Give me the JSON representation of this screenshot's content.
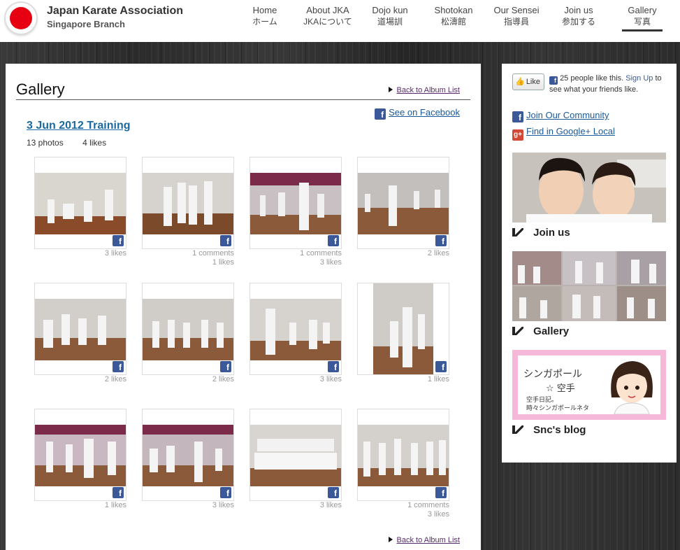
{
  "header": {
    "brand_title": "Japan Karate Association",
    "brand_sub": "Singapore Branch",
    "nav": [
      {
        "en": "Home",
        "jp": "ホーム"
      },
      {
        "en": "About JKA",
        "jp": "JKAについて"
      },
      {
        "en": "Dojo kun",
        "jp": "道場訓"
      },
      {
        "en": "Shotokan",
        "jp": "松濤館"
      },
      {
        "en": "Our Sensei",
        "jp": "指導員"
      },
      {
        "en": "Join us",
        "jp": "参加する"
      },
      {
        "en": "Gallery",
        "jp": "写真"
      }
    ],
    "active_nav": "Gallery"
  },
  "main": {
    "title": "Gallery",
    "back_link": "Back to Album List",
    "see_facebook": "See on Facebook",
    "album_title": "3 Jun 2012 Training",
    "photo_count": "13 photos",
    "like_count": "4 likes",
    "thumbs": [
      {
        "meta": [
          "3 likes"
        ]
      },
      {
        "meta": [
          "1 comments",
          "1 likes"
        ]
      },
      {
        "meta": [
          "1 comments",
          "3 likes"
        ]
      },
      {
        "meta": [
          "2 likes"
        ]
      },
      {
        "meta": [
          "2 likes"
        ]
      },
      {
        "meta": [
          "2 likes"
        ]
      },
      {
        "meta": [
          "3 likes"
        ]
      },
      {
        "meta": [
          "1 likes"
        ]
      },
      {
        "meta": [
          "1 likes"
        ]
      },
      {
        "meta": [
          "3 likes"
        ]
      },
      {
        "meta": [
          "3 likes"
        ]
      },
      {
        "meta": [
          "1 comments",
          "3 likes"
        ]
      }
    ]
  },
  "sidebar": {
    "like_button": "Like",
    "like_text_prefix": "25 people like this.",
    "like_text_link": "Sign Up",
    "like_text_suffix": "to see what your friends like.",
    "community_link": "Join Our Community",
    "google_link": "Find in Google+ Local",
    "banners": [
      {
        "label": "Join us"
      },
      {
        "label": "Gallery"
      },
      {
        "label": "Snc's blog"
      }
    ],
    "blog_text1": "シンガポール",
    "blog_text2": "☆ 空手",
    "blog_text3_line1": "空手日記。",
    "blog_text3_line2": "時々シンガポールネタ"
  },
  "colors": {
    "accent_red": "#e60012",
    "facebook_blue": "#3b5998",
    "link_blue": "#1a6aa0",
    "blog_pink": "#f6b8d8"
  },
  "icons": [
    "facebook-icon",
    "google-plus-icon",
    "arrow-bullet-icon",
    "thumbs-up-icon"
  ]
}
